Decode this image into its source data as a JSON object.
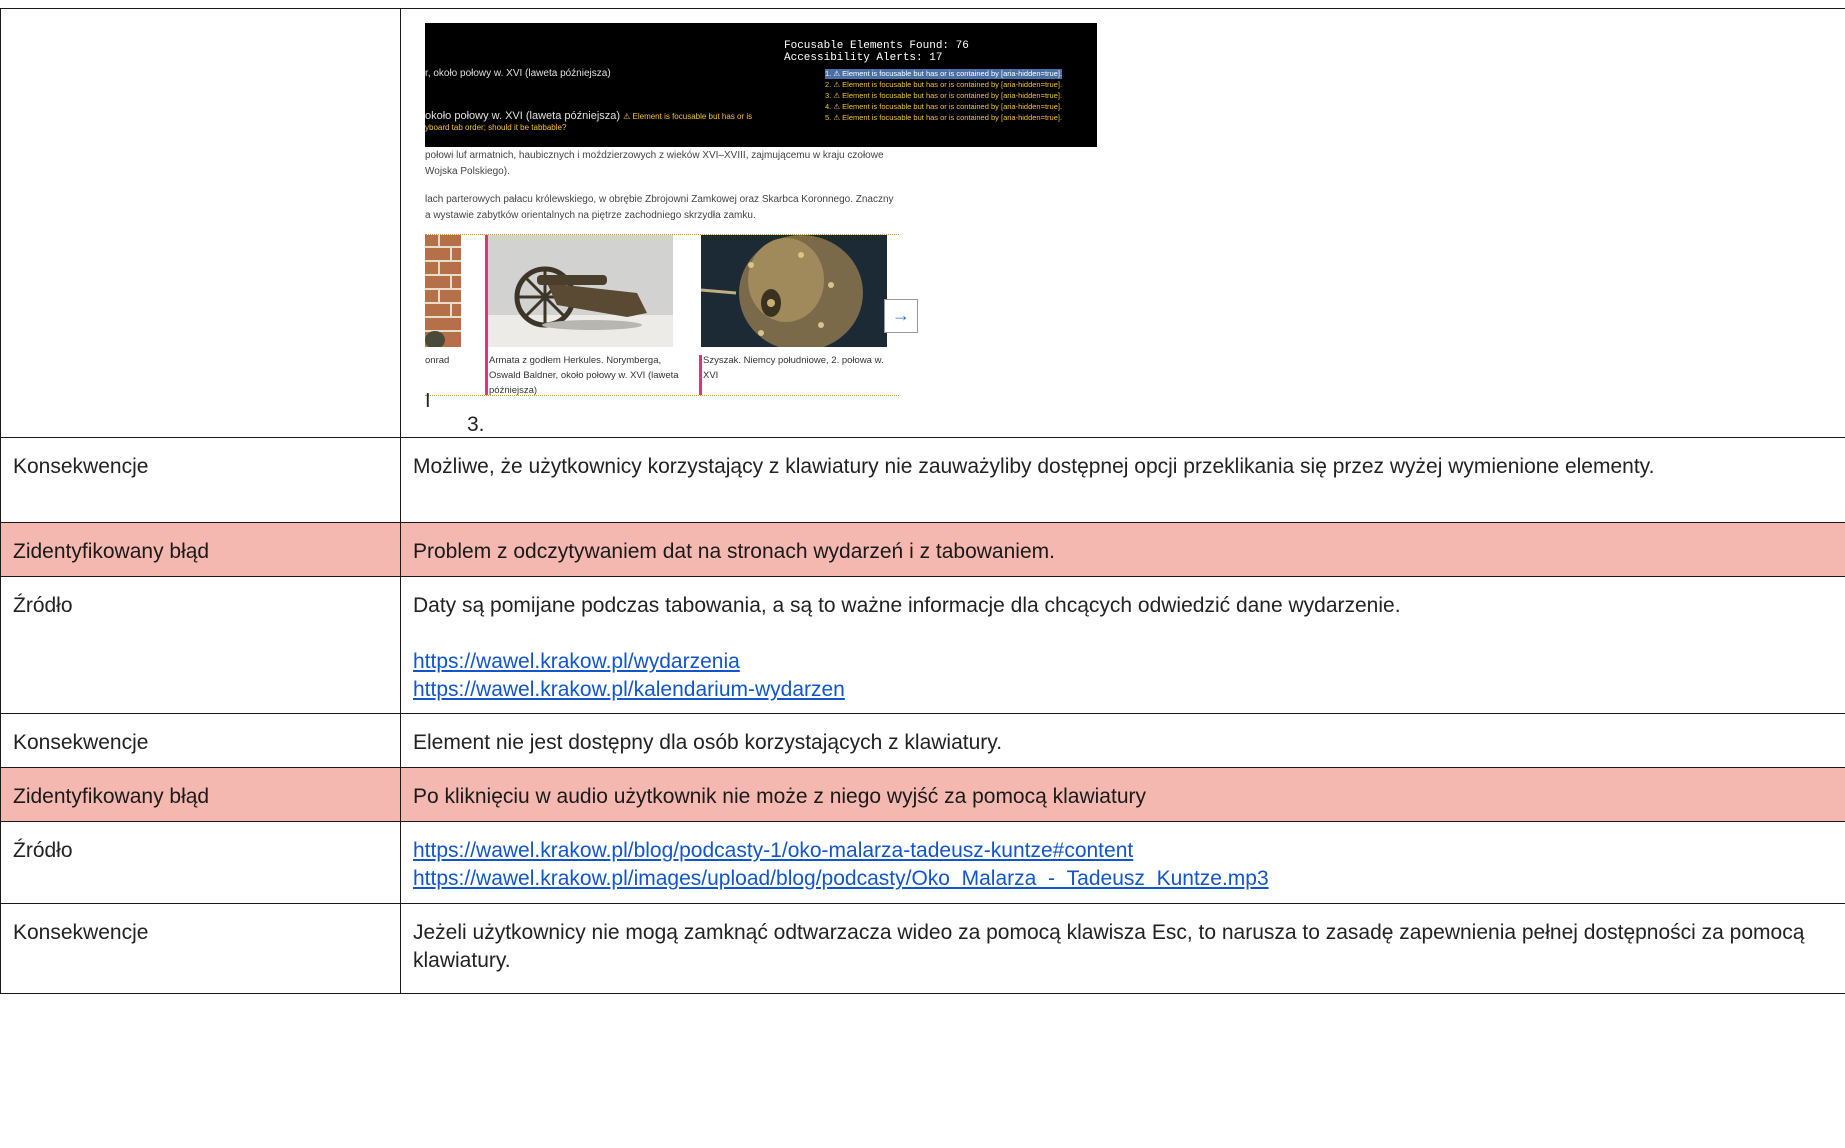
{
  "screenshot": {
    "overlay": {
      "focusable": "Focusable Elements Found: 76",
      "alerts_count": "Accessibility Alerts: 17",
      "left_line1": "r, około połowy w. XVI (laweta późniejsza)",
      "left_line2": "około połowy w. XVI (laweta późniejsza)",
      "left_warn": "⚠ Element is focusable but has or is",
      "left_line3": "yboard tab order; should it be tabbable?",
      "alerts": [
        "1. ⚠ Element is focusable but has or is contained by [aria-hidden=true].",
        "2. ⚠ Element is focusable but has or is contained by [aria-hidden=true].",
        "3. ⚠ Element is focusable but has or is contained by [aria-hidden=true].",
        "4. ⚠ Element is focusable but has or is contained by [aria-hidden=true].",
        "5. ⚠ Element is focusable but has or is contained by [aria-hidden=true]."
      ]
    },
    "para1_a": "połowi luf armatnich, haubicznych i moździerzowych z wieków XVI–XVIII, zajmującemu w kraju czołowe",
    "para1_b": "Wojska Polskiego).",
    "para2_a": "lach parterowych pałacu królewskiego, w obrębie Zbrojowni Zamkowej oraz Skarbca Koronnego. Znaczny",
    "para2_b": "a wystawie zabytków orientalnych na piętrze zachodniego skrzydła zamku.",
    "caption_left": "onrad",
    "caption_mid": "Armata z godłem Herkules. Norymberga, Oswald Baldner, około połowy w. XVI (laweta późniejsza)",
    "caption_right": "Szyszak. Niemcy południowe, 2. połowa w. XVI",
    "next_arrow": "→",
    "cursor": "I",
    "list_number": "3."
  },
  "rows": [
    {
      "label": "Konsekwencje",
      "text": "Możliwe, że użytkownicy korzystający z klawiatury nie zauważyliby dostępnej opcji przeklikania się przez wyżej wymienione elementy."
    },
    {
      "label": "Zidentyfikowany błąd",
      "text": "Problem z odczytywaniem dat na stronach wydarzeń i z tabowaniem."
    },
    {
      "label": "Źródło",
      "text": "Daty są pomijane podczas tabowania,  a są to ważne informacje dla chcących odwiedzić dane wydarzenie.",
      "links": [
        "https://wawel.krakow.pl/wydarzenia",
        "https://wawel.krakow.pl/kalendarium-wydarzen"
      ]
    },
    {
      "label": "Konsekwencje",
      "text": "Element nie jest dostępny dla osób korzystających z klawiatury."
    },
    {
      "label": "Zidentyfikowany błąd",
      "text": "Po kliknięciu w audio użytkownik nie może z niego wyjść za pomocą klawiatury"
    },
    {
      "label": "Źródło",
      "links": [
        "https://wawel.krakow.pl/blog/podcasty-1/oko-malarza-tadeusz-kuntze#content",
        "https://wawel.krakow.pl/images/upload/blog/podcasty/Oko_Malarza_-_Tadeusz_Kuntze.mp3"
      ]
    },
    {
      "label": "Konsekwencje",
      "text": "Jeżeli użytkownicy nie mogą zamknąć odtwarzacza wideo za pomocą klawisza Esc, to narusza to zasadę zapewnienia pełnej dostępności za pomocą klawiatury."
    }
  ]
}
